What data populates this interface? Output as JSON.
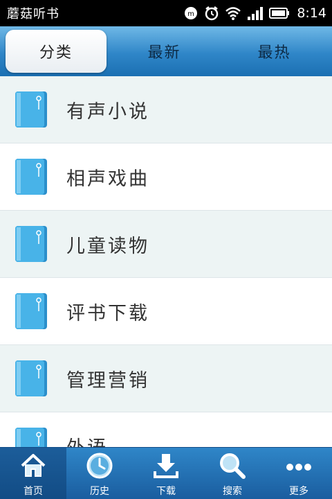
{
  "status_bar": {
    "app_name": "蘑菇听书",
    "time": "8:14",
    "icons": [
      "notification-icon",
      "alarm-icon",
      "wifi-icon",
      "signal-icon",
      "battery-icon"
    ]
  },
  "tabs": [
    {
      "label": "分类",
      "active": true
    },
    {
      "label": "最新",
      "active": false
    },
    {
      "label": "最热",
      "active": false
    }
  ],
  "categories": [
    {
      "label": "有声小说"
    },
    {
      "label": "相声戏曲"
    },
    {
      "label": "儿童读物"
    },
    {
      "label": "评书下载"
    },
    {
      "label": "管理营销"
    },
    {
      "label": "外语"
    }
  ],
  "bottom_nav": [
    {
      "label": "首页",
      "icon": "home-icon",
      "active": true
    },
    {
      "label": "历史",
      "icon": "clock-icon",
      "active": false
    },
    {
      "label": "下载",
      "icon": "download-icon",
      "active": false
    },
    {
      "label": "搜索",
      "icon": "search-icon",
      "active": false
    },
    {
      "label": "更多",
      "icon": "more-icon",
      "active": false
    }
  ],
  "colors": {
    "accent": "#2f86c8",
    "book_icon": "#3fa8e0"
  }
}
